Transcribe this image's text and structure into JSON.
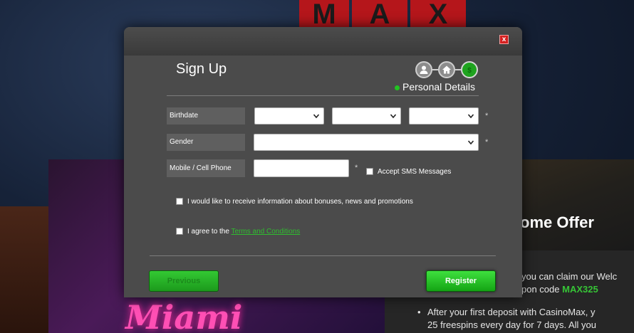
{
  "background": {
    "logo_letters": [
      "M",
      "A",
      "X"
    ],
    "game_title": "Miami",
    "offer_heading": "ome Offer",
    "offer_lines": {
      "line1": "you can claim our Welc",
      "line2_prefix": "pon code ",
      "line2_code": "MAX325",
      "line3": "After your first deposit with CasinoMax, y",
      "line4": "25 freespins every day for 7 days. All you"
    },
    "bullet": "•"
  },
  "modal": {
    "close_label": "x",
    "title": "Sign Up",
    "steps": [
      "user-icon",
      "home-icon",
      "dollar-icon"
    ],
    "active_step_label": "Personal Details",
    "fields": {
      "birthdate_label": "Birthdate",
      "gender_label": "Gender",
      "mobile_label": "Mobile / Cell Phone",
      "required_marker": "*"
    },
    "sms_label": "Accept SMS Messages",
    "bonus_label": "I would like to receive information about bonuses, news and promotions",
    "terms_prefix": "I agree to the ",
    "terms_link": "Terms and Conditions",
    "previous_label": "Previous",
    "register_label": "Register"
  },
  "colors": {
    "accent_green": "#22c322",
    "close_red": "#d42020",
    "modal_bg": "#4b4b4b"
  }
}
